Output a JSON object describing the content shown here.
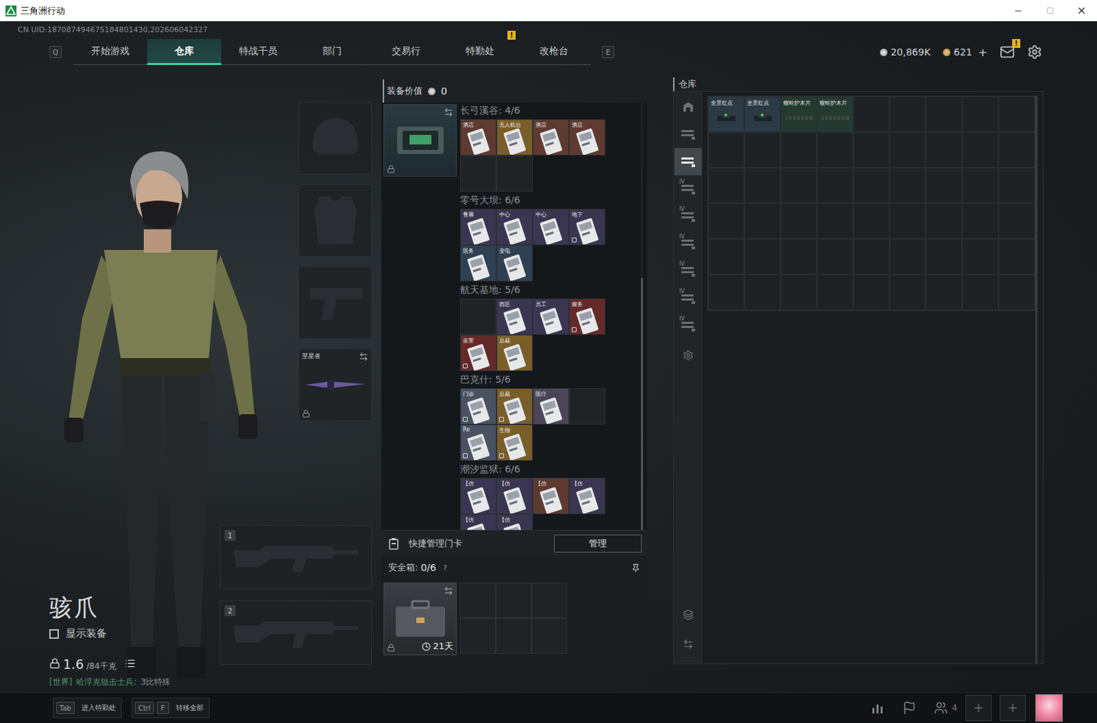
{
  "window": {
    "title": "三角洲行动"
  },
  "uid": "CN UID:187087494675184801430,202606042327",
  "nav": {
    "prev_key": "Q",
    "next_key": "E",
    "tabs": [
      {
        "label": "开始游戏",
        "selected": false,
        "badge": ""
      },
      {
        "label": "仓库",
        "selected": true,
        "badge": ""
      },
      {
        "label": "特战干员",
        "selected": false,
        "badge": ""
      },
      {
        "label": "部门",
        "selected": false,
        "badge": ""
      },
      {
        "label": "交易行",
        "selected": false,
        "badge": ""
      },
      {
        "label": "特勤处",
        "selected": false,
        "badge": "!"
      },
      {
        "label": "改枪台",
        "selected": false,
        "badge": ""
      }
    ]
  },
  "currency": {
    "silver": "20,869K",
    "gold": "621",
    "add": "+"
  },
  "mail": {
    "badge": "!"
  },
  "operator": {
    "name": "骇爪",
    "show_equipment": {
      "label": "显示装备",
      "checked": false
    },
    "weight": "1.6",
    "capacity": "/84千克",
    "chat": {
      "channel": "[世界]",
      "sender": "哈浮克狙击士兵:",
      "message": "3比特殊"
    }
  },
  "equipment": [
    {
      "kind": "helmet",
      "label": "",
      "locked": false
    },
    {
      "kind": "armor",
      "label": "",
      "locked": false
    },
    {
      "kind": "pistol",
      "label": "",
      "locked": false
    },
    {
      "kind": "melee",
      "label": "至星者",
      "locked": true
    }
  ],
  "weapons": [
    {
      "number": "1"
    },
    {
      "number": "2"
    }
  ],
  "loadout": {
    "title": "装备价值",
    "value": "0"
  },
  "keycards": {
    "holder_locked": true,
    "scroll": {
      "start": 0.41,
      "end": 1.0
    },
    "sections": [
      {
        "title": "长弓溪谷: 4/6",
        "slots": [
          {
            "kind": "card",
            "label": "酒店",
            "color": "#5e3a30",
            "marked": false
          },
          {
            "kind": "card",
            "label": "无人机台",
            "color": "#7a5e2a",
            "marked": false
          },
          {
            "kind": "card",
            "label": "酒店",
            "color": "#5e3a30",
            "marked": false
          },
          {
            "kind": "card",
            "label": "酒店",
            "color": "#5e3a30",
            "marked": false
          },
          {
            "kind": "empty"
          },
          {
            "kind": "empty"
          }
        ]
      },
      {
        "title": "零号大坝: 6/6",
        "slots": [
          {
            "kind": "card",
            "label": "售票",
            "color": "#3a3550",
            "marked": false
          },
          {
            "kind": "card",
            "label": "中心",
            "color": "#3a3550",
            "marked": false
          },
          {
            "kind": "card",
            "label": "中心",
            "color": "#3a3550",
            "marked": false
          },
          {
            "kind": "card",
            "label": "地下",
            "color": "#3a3550",
            "marked": true
          },
          {
            "kind": "card",
            "label": "医务",
            "color": "#2e4052",
            "marked": false
          },
          {
            "kind": "card",
            "label": "变电",
            "color": "#2e4052",
            "marked": false
          }
        ]
      },
      {
        "title": "航天基地: 5/6",
        "slots": [
          {
            "kind": "empty"
          },
          {
            "kind": "card",
            "label": "西区",
            "color": "#3a3550",
            "marked": false
          },
          {
            "kind": "card",
            "label": "员工",
            "color": "#3a3550",
            "marked": false
          },
          {
            "kind": "card",
            "label": "服务",
            "color": "#642a2a",
            "marked": true
          },
          {
            "kind": "card",
            "label": "蓝室",
            "color": "#642a2a",
            "marked": true
          },
          {
            "kind": "card",
            "label": "总裁",
            "color": "#7a5e2a",
            "marked": false
          }
        ]
      },
      {
        "title": "巴克什: 5/6",
        "slots": [
          {
            "kind": "card",
            "label": "门诊",
            "color": "#4a5262",
            "marked": true
          },
          {
            "kind": "card",
            "label": "总裁",
            "color": "#7a5e2a",
            "marked": true
          },
          {
            "kind": "card",
            "label": "医疗",
            "color": "#4a4658",
            "marked": false
          },
          {
            "kind": "empty"
          },
          {
            "kind": "card",
            "label": "Re",
            "color": "#4a5262",
            "marked": true
          },
          {
            "kind": "card",
            "label": "生物",
            "color": "#7a5e2a",
            "marked": true
          }
        ]
      },
      {
        "title": "潮汐监狱: 6/6",
        "slots": [
          {
            "kind": "card",
            "label": "【仿",
            "color": "#3a3550",
            "marked": false
          },
          {
            "kind": "card",
            "label": "【仿",
            "color": "#3a3550",
            "marked": false
          },
          {
            "kind": "card",
            "label": "【仿",
            "color": "#5e3a30",
            "marked": false
          },
          {
            "kind": "card",
            "label": "【仿",
            "color": "#3a3550",
            "marked": false
          },
          {
            "kind": "card",
            "label": "【仿",
            "color": "#3a3550",
            "marked": false
          },
          {
            "kind": "card",
            "label": "【仿",
            "color": "#3a3550",
            "marked": false
          }
        ]
      }
    ]
  },
  "quick_manage": {
    "label": "快捷管理门卡",
    "button": "管理"
  },
  "safe_box": {
    "title": "安全箱:",
    "count": "0/6",
    "help": "?",
    "timer": "21天",
    "locked": true
  },
  "warehouse": {
    "title": "仓库",
    "tabs": [
      {
        "tag": "",
        "selected": false
      },
      {
        "tag": "",
        "selected": false
      },
      {
        "tag": "",
        "selected": true
      },
      {
        "tag": "IV",
        "selected": false
      },
      {
        "tag": "IV",
        "selected": false
      },
      {
        "tag": "IV",
        "selected": false
      },
      {
        "tag": "IV",
        "selected": false
      },
      {
        "tag": "IV",
        "selected": false
      },
      {
        "tag": "IV",
        "selected": false
      }
    ],
    "items": [
      {
        "name": "全景红点",
        "kind": "scope",
        "color": "#2c3a46"
      },
      {
        "name": "全景红点",
        "kind": "scope",
        "color": "#2c3a46"
      },
      {
        "name": "蝮蛇护木片",
        "kind": "handguard",
        "color": "#243a30"
      },
      {
        "name": "蝮蛇护木片",
        "kind": "handguard",
        "color": "#243a30"
      }
    ]
  },
  "bottom_bar": {
    "hints": [
      {
        "keys": [
          "Tab"
        ],
        "label": "进入特勤处"
      },
      {
        "keys": [
          "Ctrl",
          "F"
        ],
        "label": "转移全部"
      }
    ],
    "friends": "4"
  }
}
